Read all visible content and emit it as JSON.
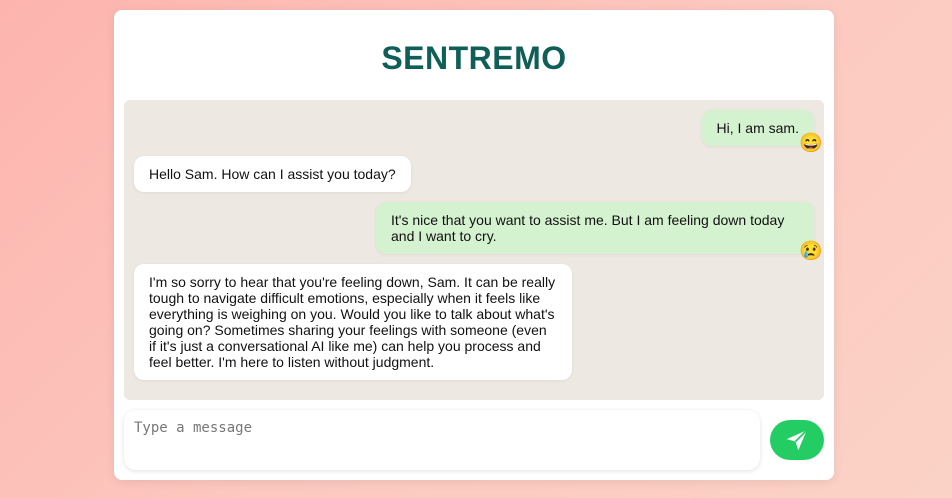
{
  "app": {
    "title": "SENTREMO"
  },
  "messages": [
    {
      "sender": "user",
      "text": "Hi, I am sam.",
      "emoji": "😄"
    },
    {
      "sender": "bot",
      "text": "Hello Sam. How can I assist you today?"
    },
    {
      "sender": "user",
      "text": "It's nice that you want to assist me. But I am feeling down today and I want to cry.",
      "emoji": "😢"
    },
    {
      "sender": "bot",
      "text": "I'm so sorry to hear that you're feeling down, Sam. It can be really tough to navigate difficult emotions, especially when it feels like everything is weighing on you. Would you like to talk about what's going on? Sometimes sharing your feelings with someone (even if it's just a conversational AI like me) can help you process and feel better. I'm here to listen without judgment."
    }
  ],
  "composer": {
    "placeholder": "Type a message",
    "value": ""
  },
  "icons": {
    "send": "send-icon"
  },
  "colors": {
    "title": "#0f5e57",
    "user_bubble": "#d5f2d0",
    "bot_bubble": "#ffffff",
    "chat_bg": "#ede8e1",
    "send_button": "#23cd64"
  }
}
